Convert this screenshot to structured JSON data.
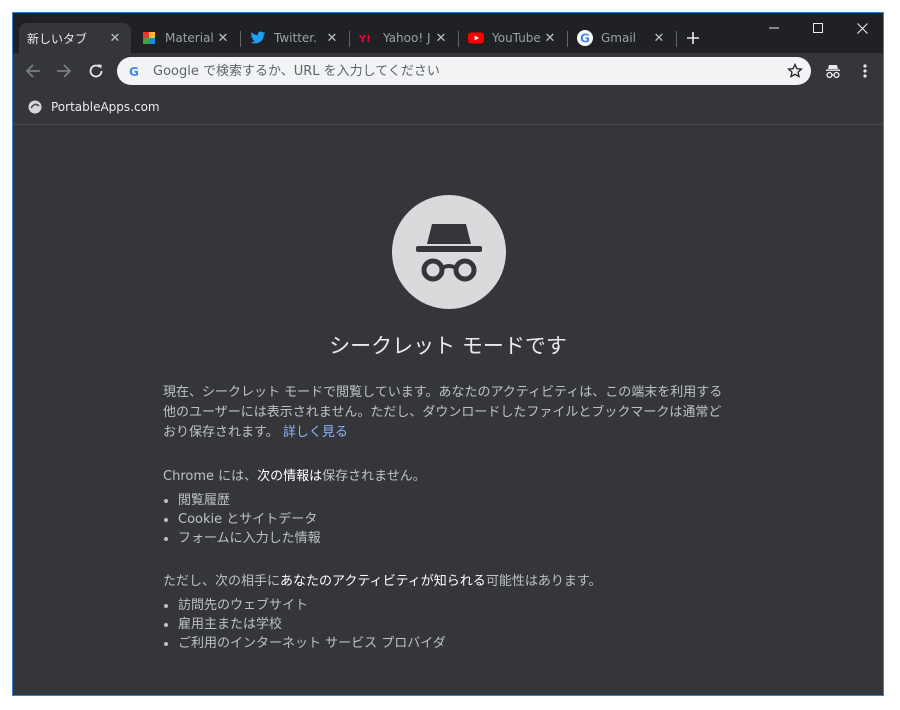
{
  "tabs": [
    {
      "label": "新しいタブ",
      "icon": "none",
      "active": true
    },
    {
      "label": "Material",
      "icon": "material-icon"
    },
    {
      "label": "Twitter.",
      "icon": "twitter-icon"
    },
    {
      "label": "Yahoo! J",
      "icon": "yahoo-icon"
    },
    {
      "label": "YouTube",
      "icon": "youtube-icon"
    },
    {
      "label": "Gmail",
      "icon": "google-icon"
    }
  ],
  "omnibox": {
    "placeholder": "Google で検索するか、URL を入力してください"
  },
  "bookmarks": [
    {
      "label": "PortableApps.com",
      "icon": "portableapps-icon"
    }
  ],
  "content": {
    "title": "シークレット モードです",
    "intro": "現在、シークレット モードで閲覧しています。あなたのアクティビティは、この端末を利用する他のユーザーには表示されません。ただし、ダウンロードしたファイルとブックマークは通常どおり保存されます。",
    "learn_more": "詳しく見る",
    "not_saved": {
      "prefix": "Chrome には、",
      "bold": "次の情報は",
      "suffix": "保存されません。",
      "items": [
        "閲覧履歴",
        "Cookie とサイトデータ",
        "フォームに入力した情報"
      ]
    },
    "visible_to": {
      "prefix": "ただし、次の相手に",
      "bold": "あなたのアクティビティが知られる",
      "suffix": "可能性はあります。",
      "items": [
        "訪問先のウェブサイト",
        "雇用主または学校",
        "ご利用のインターネット サービス プロバイダ"
      ]
    }
  },
  "colors": {
    "frame": "#202124",
    "toolbar": "#35363a",
    "link": "#8ab4f8",
    "text": "#bdc1c6"
  }
}
